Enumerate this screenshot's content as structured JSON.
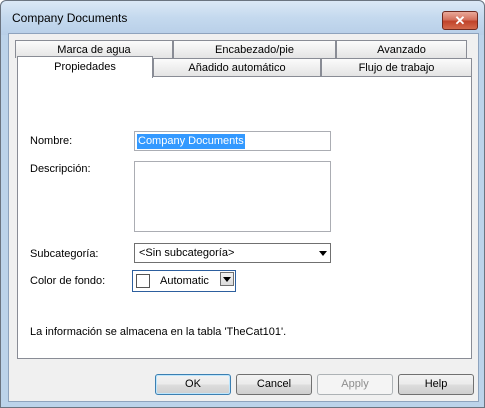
{
  "window": {
    "title": "Company Documents",
    "close_glyph": "✕"
  },
  "tabs": {
    "row_back": [
      "Marca de agua",
      "Encabezado/pie",
      "Avanzado"
    ],
    "row_front": [
      "Propiedades",
      "Añadido automático",
      "Flujo de trabajo"
    ],
    "active": "Propiedades"
  },
  "form": {
    "name_label": "Nombre:",
    "name_value": "Company Documents",
    "description_label": "Descripción:",
    "description_value": "",
    "subcategory_label": "Subcategoría:",
    "subcategory_value": "<Sin subcategoría>",
    "bgcolor_label": "Color de fondo:",
    "bgcolor_value": "Automatic",
    "info_text": "La información se almacena en la tabla 'TheCat101'."
  },
  "buttons": {
    "ok": "OK",
    "cancel": "Cancel",
    "apply": "Apply",
    "help": "Help"
  },
  "icons": {
    "close": "close-icon",
    "dropdown": "chevron-down-icon"
  }
}
